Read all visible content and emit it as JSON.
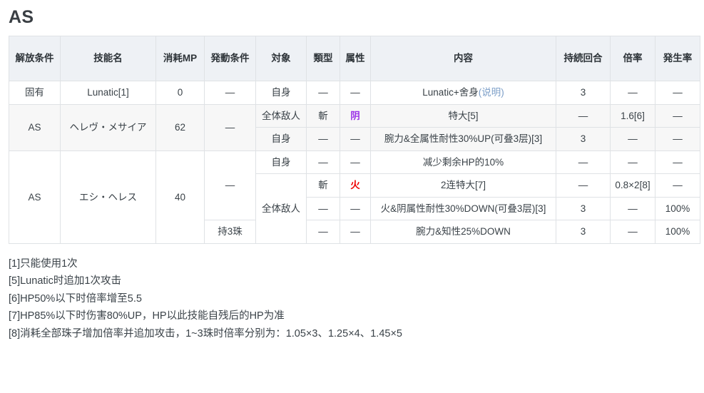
{
  "page": {
    "title": "AS"
  },
  "table": {
    "headers": [
      "解放条件",
      "技能名",
      "消耗MP",
      "発動条件",
      "対象",
      "類型",
      "属性",
      "内容",
      "持続回合",
      "倍率",
      "発生率"
    ],
    "groups": [
      {
        "unlock": "固有",
        "name": "Lunatic[1]",
        "mp": "0",
        "condition": "—",
        "striped": false,
        "rows": [
          {
            "target": "自身",
            "type": "—",
            "attr": "—",
            "attr_color": "default",
            "content": "Lunatic+舍身",
            "content_link": "(说明)",
            "turns": "3",
            "rate": "—",
            "proc": "—"
          }
        ]
      },
      {
        "unlock": "AS",
        "name": "ヘレヴ・メサイア",
        "mp": "62",
        "condition": "—",
        "striped": true,
        "rows": [
          {
            "target": "全体敌人",
            "type": "斬",
            "attr": "阴",
            "attr_color": "yin",
            "content": "特大[5]",
            "content_link": "",
            "turns": "—",
            "rate": "1.6[6]",
            "proc": "—"
          },
          {
            "target": "自身",
            "type": "—",
            "attr": "—",
            "attr_color": "default",
            "content": "腕力&全属性耐性30%UP(可叠3层)[3]",
            "content_link": "",
            "turns": "3",
            "rate": "—",
            "proc": "—"
          }
        ]
      },
      {
        "unlock": "AS",
        "name": "エシ・ヘレス",
        "mp": "40",
        "condition": "—",
        "condition2": "持3珠",
        "striped": false,
        "rows": [
          {
            "target": "自身",
            "type": "—",
            "attr": "—",
            "attr_color": "default",
            "content": "减少剩余HP的10%",
            "content_link": "",
            "turns": "—",
            "rate": "—",
            "proc": "—"
          },
          {
            "target": "全体敌人",
            "type": "斬",
            "attr": "火",
            "attr_color": "huo",
            "content": "2连特大[7]",
            "content_link": "",
            "turns": "—",
            "rate": "0.8×2[8]",
            "proc": "—"
          },
          {
            "target": "",
            "type": "—",
            "attr": "—",
            "attr_color": "default",
            "content": "火&阴属性耐性30%DOWN(可叠3层)[3]",
            "content_link": "",
            "turns": "3",
            "rate": "—",
            "proc": "100%"
          },
          {
            "target": "",
            "type": "—",
            "attr": "—",
            "attr_color": "default",
            "content": "腕力&知性25%DOWN",
            "content_link": "",
            "turns": "3",
            "rate": "—",
            "proc": "100%"
          }
        ]
      }
    ]
  },
  "footnotes": [
    "[1]只能使用1次",
    "[5]Lunatic时追加1次攻击",
    "[6]HP50%以下时倍率增至5.5",
    "[7]HP85%以下时伤害80%UP，HP以此技能自残后的HP为准",
    "[8]消耗全部珠子增加倍率并追加攻击，1~3珠时倍率分别为：1.05×3、1.25×4、1.45×5"
  ],
  "colors": {
    "header_bg": "#eef1f5",
    "stripe_bg": "#f7f7f7",
    "border": "#dfe2e5",
    "attr_yin": "#9b30e8",
    "attr_huo": "#ee0000",
    "link": "#7d9fc8"
  }
}
